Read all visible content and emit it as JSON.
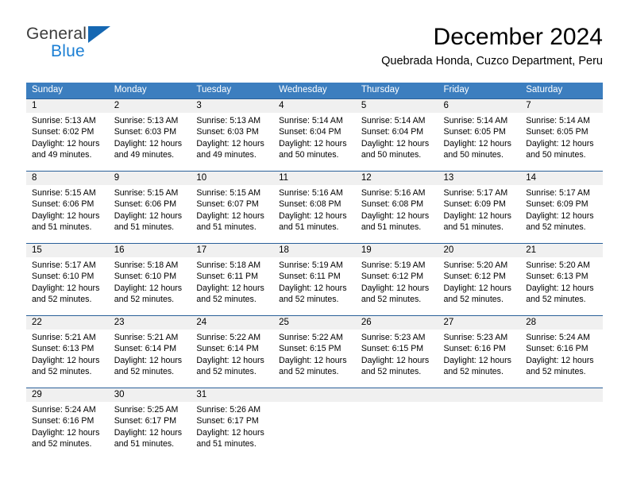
{
  "brand": {
    "name_part1": "General",
    "name_part2": "Blue",
    "accent_color": "#1b7fd4",
    "triangle_color": "#1567b2"
  },
  "header": {
    "title": "December 2024",
    "subtitle": "Quebrada Honda, Cuzco Department, Peru"
  },
  "calendar": {
    "header_bg": "#3c7ebf",
    "row_border_color": "#2a6099",
    "daynum_bg": "#f0f0f0",
    "weekday_headers": [
      "Sunday",
      "Monday",
      "Tuesday",
      "Wednesday",
      "Thursday",
      "Friday",
      "Saturday"
    ],
    "labels": {
      "sunrise": "Sunrise:",
      "sunset": "Sunset:",
      "daylight": "Daylight:"
    },
    "weeks": [
      [
        {
          "day": "1",
          "sunrise": "Sunrise: 5:13 AM",
          "sunset": "Sunset: 6:02 PM",
          "daylight_line1": "Daylight: 12 hours",
          "daylight_line2": "and 49 minutes."
        },
        {
          "day": "2",
          "sunrise": "Sunrise: 5:13 AM",
          "sunset": "Sunset: 6:03 PM",
          "daylight_line1": "Daylight: 12 hours",
          "daylight_line2": "and 49 minutes."
        },
        {
          "day": "3",
          "sunrise": "Sunrise: 5:13 AM",
          "sunset": "Sunset: 6:03 PM",
          "daylight_line1": "Daylight: 12 hours",
          "daylight_line2": "and 49 minutes."
        },
        {
          "day": "4",
          "sunrise": "Sunrise: 5:14 AM",
          "sunset": "Sunset: 6:04 PM",
          "daylight_line1": "Daylight: 12 hours",
          "daylight_line2": "and 50 minutes."
        },
        {
          "day": "5",
          "sunrise": "Sunrise: 5:14 AM",
          "sunset": "Sunset: 6:04 PM",
          "daylight_line1": "Daylight: 12 hours",
          "daylight_line2": "and 50 minutes."
        },
        {
          "day": "6",
          "sunrise": "Sunrise: 5:14 AM",
          "sunset": "Sunset: 6:05 PM",
          "daylight_line1": "Daylight: 12 hours",
          "daylight_line2": "and 50 minutes."
        },
        {
          "day": "7",
          "sunrise": "Sunrise: 5:14 AM",
          "sunset": "Sunset: 6:05 PM",
          "daylight_line1": "Daylight: 12 hours",
          "daylight_line2": "and 50 minutes."
        }
      ],
      [
        {
          "day": "8",
          "sunrise": "Sunrise: 5:15 AM",
          "sunset": "Sunset: 6:06 PM",
          "daylight_line1": "Daylight: 12 hours",
          "daylight_line2": "and 51 minutes."
        },
        {
          "day": "9",
          "sunrise": "Sunrise: 5:15 AM",
          "sunset": "Sunset: 6:06 PM",
          "daylight_line1": "Daylight: 12 hours",
          "daylight_line2": "and 51 minutes."
        },
        {
          "day": "10",
          "sunrise": "Sunrise: 5:15 AM",
          "sunset": "Sunset: 6:07 PM",
          "daylight_line1": "Daylight: 12 hours",
          "daylight_line2": "and 51 minutes."
        },
        {
          "day": "11",
          "sunrise": "Sunrise: 5:16 AM",
          "sunset": "Sunset: 6:08 PM",
          "daylight_line1": "Daylight: 12 hours",
          "daylight_line2": "and 51 minutes."
        },
        {
          "day": "12",
          "sunrise": "Sunrise: 5:16 AM",
          "sunset": "Sunset: 6:08 PM",
          "daylight_line1": "Daylight: 12 hours",
          "daylight_line2": "and 51 minutes."
        },
        {
          "day": "13",
          "sunrise": "Sunrise: 5:17 AM",
          "sunset": "Sunset: 6:09 PM",
          "daylight_line1": "Daylight: 12 hours",
          "daylight_line2": "and 51 minutes."
        },
        {
          "day": "14",
          "sunrise": "Sunrise: 5:17 AM",
          "sunset": "Sunset: 6:09 PM",
          "daylight_line1": "Daylight: 12 hours",
          "daylight_line2": "and 52 minutes."
        }
      ],
      [
        {
          "day": "15",
          "sunrise": "Sunrise: 5:17 AM",
          "sunset": "Sunset: 6:10 PM",
          "daylight_line1": "Daylight: 12 hours",
          "daylight_line2": "and 52 minutes."
        },
        {
          "day": "16",
          "sunrise": "Sunrise: 5:18 AM",
          "sunset": "Sunset: 6:10 PM",
          "daylight_line1": "Daylight: 12 hours",
          "daylight_line2": "and 52 minutes."
        },
        {
          "day": "17",
          "sunrise": "Sunrise: 5:18 AM",
          "sunset": "Sunset: 6:11 PM",
          "daylight_line1": "Daylight: 12 hours",
          "daylight_line2": "and 52 minutes."
        },
        {
          "day": "18",
          "sunrise": "Sunrise: 5:19 AM",
          "sunset": "Sunset: 6:11 PM",
          "daylight_line1": "Daylight: 12 hours",
          "daylight_line2": "and 52 minutes."
        },
        {
          "day": "19",
          "sunrise": "Sunrise: 5:19 AM",
          "sunset": "Sunset: 6:12 PM",
          "daylight_line1": "Daylight: 12 hours",
          "daylight_line2": "and 52 minutes."
        },
        {
          "day": "20",
          "sunrise": "Sunrise: 5:20 AM",
          "sunset": "Sunset: 6:12 PM",
          "daylight_line1": "Daylight: 12 hours",
          "daylight_line2": "and 52 minutes."
        },
        {
          "day": "21",
          "sunrise": "Sunrise: 5:20 AM",
          "sunset": "Sunset: 6:13 PM",
          "daylight_line1": "Daylight: 12 hours",
          "daylight_line2": "and 52 minutes."
        }
      ],
      [
        {
          "day": "22",
          "sunrise": "Sunrise: 5:21 AM",
          "sunset": "Sunset: 6:13 PM",
          "daylight_line1": "Daylight: 12 hours",
          "daylight_line2": "and 52 minutes."
        },
        {
          "day": "23",
          "sunrise": "Sunrise: 5:21 AM",
          "sunset": "Sunset: 6:14 PM",
          "daylight_line1": "Daylight: 12 hours",
          "daylight_line2": "and 52 minutes."
        },
        {
          "day": "24",
          "sunrise": "Sunrise: 5:22 AM",
          "sunset": "Sunset: 6:14 PM",
          "daylight_line1": "Daylight: 12 hours",
          "daylight_line2": "and 52 minutes."
        },
        {
          "day": "25",
          "sunrise": "Sunrise: 5:22 AM",
          "sunset": "Sunset: 6:15 PM",
          "daylight_line1": "Daylight: 12 hours",
          "daylight_line2": "and 52 minutes."
        },
        {
          "day": "26",
          "sunrise": "Sunrise: 5:23 AM",
          "sunset": "Sunset: 6:15 PM",
          "daylight_line1": "Daylight: 12 hours",
          "daylight_line2": "and 52 minutes."
        },
        {
          "day": "27",
          "sunrise": "Sunrise: 5:23 AM",
          "sunset": "Sunset: 6:16 PM",
          "daylight_line1": "Daylight: 12 hours",
          "daylight_line2": "and 52 minutes."
        },
        {
          "day": "28",
          "sunrise": "Sunrise: 5:24 AM",
          "sunset": "Sunset: 6:16 PM",
          "daylight_line1": "Daylight: 12 hours",
          "daylight_line2": "and 52 minutes."
        }
      ],
      [
        {
          "day": "29",
          "sunrise": "Sunrise: 5:24 AM",
          "sunset": "Sunset: 6:16 PM",
          "daylight_line1": "Daylight: 12 hours",
          "daylight_line2": "and 52 minutes."
        },
        {
          "day": "30",
          "sunrise": "Sunrise: 5:25 AM",
          "sunset": "Sunset: 6:17 PM",
          "daylight_line1": "Daylight: 12 hours",
          "daylight_line2": "and 51 minutes."
        },
        {
          "day": "31",
          "sunrise": "Sunrise: 5:26 AM",
          "sunset": "Sunset: 6:17 PM",
          "daylight_line1": "Daylight: 12 hours",
          "daylight_line2": "and 51 minutes."
        },
        {
          "day": "",
          "sunrise": "",
          "sunset": "",
          "daylight_line1": "",
          "daylight_line2": ""
        },
        {
          "day": "",
          "sunrise": "",
          "sunset": "",
          "daylight_line1": "",
          "daylight_line2": ""
        },
        {
          "day": "",
          "sunrise": "",
          "sunset": "",
          "daylight_line1": "",
          "daylight_line2": ""
        },
        {
          "day": "",
          "sunrise": "",
          "sunset": "",
          "daylight_line1": "",
          "daylight_line2": ""
        }
      ]
    ]
  }
}
